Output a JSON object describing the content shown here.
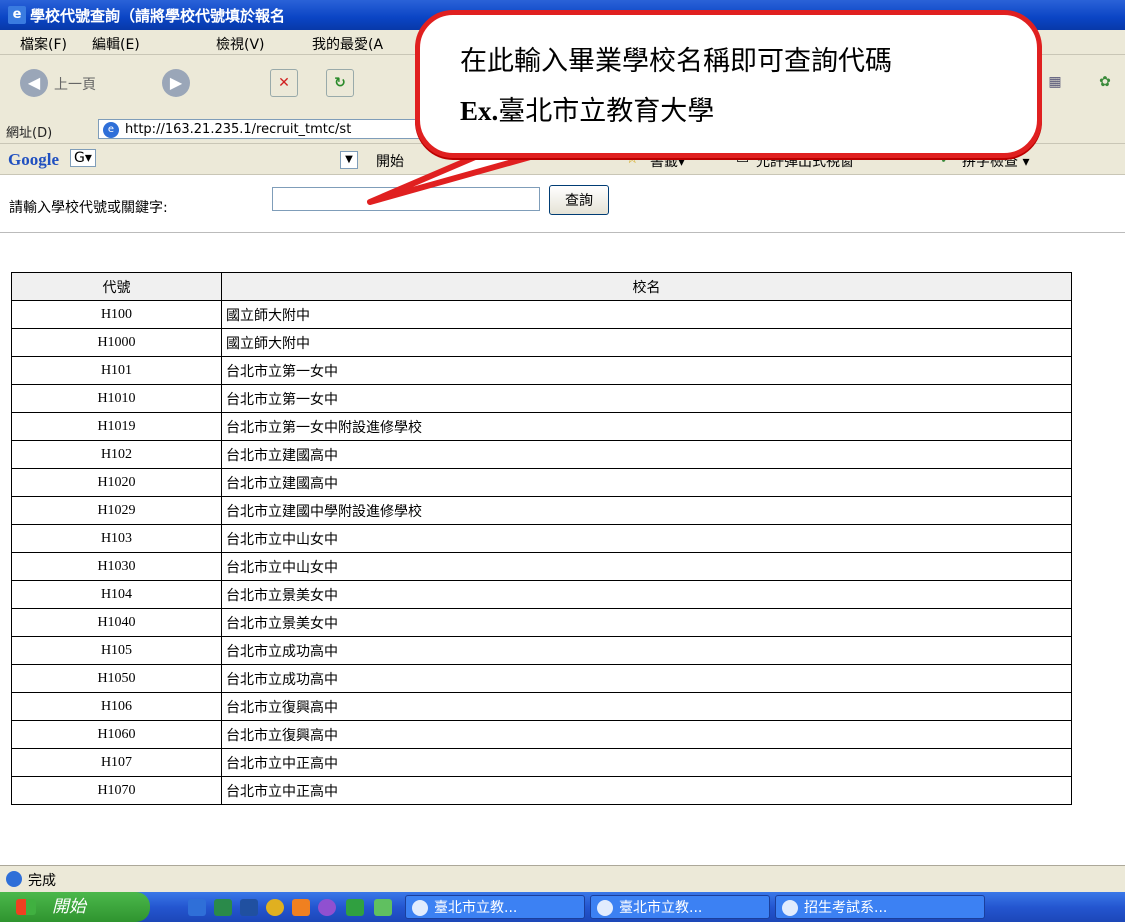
{
  "window": {
    "title": "學校代號查詢（請將學校代號填於報名"
  },
  "menu": {
    "file": "檔案(F)",
    "edit": "編輯(E)",
    "view": "檢視(V)",
    "favorites": "我的最愛(A"
  },
  "toolbar": {
    "back_label": "上一頁"
  },
  "address": {
    "label": "網址(D)",
    "url": "http://163.21.235.1/recruit_tmtc/st"
  },
  "googlebar": {
    "brand": "Google",
    "g_box": "G▾",
    "start": "開始",
    "bookmarks": "書籤▾",
    "popups": "允許彈出式視窗",
    "spellcheck": "拼字檢查 ▾"
  },
  "search": {
    "label": "請輸入學校代號或關鍵字:",
    "value": "",
    "button": "查詢"
  },
  "callout": {
    "line1": "在此輸入畢業學校名稱即可查詢代碼",
    "line2_prefix": "Ex.",
    "line2_rest": "臺北市立教育大學"
  },
  "table": {
    "headers": [
      "代號",
      "校名"
    ],
    "rows": [
      [
        "H100",
        "國立師大附中"
      ],
      [
        "H1000",
        "國立師大附中"
      ],
      [
        "H101",
        "台北市立第一女中"
      ],
      [
        "H1010",
        "台北市立第一女中"
      ],
      [
        "H1019",
        "台北市立第一女中附設進修學校"
      ],
      [
        "H102",
        "台北市立建國高中"
      ],
      [
        "H1020",
        "台北市立建國高中"
      ],
      [
        "H1029",
        "台北市立建國中學附設進修學校"
      ],
      [
        "H103",
        "台北市立中山女中"
      ],
      [
        "H1030",
        "台北市立中山女中"
      ],
      [
        "H104",
        "台北市立景美女中"
      ],
      [
        "H1040",
        "台北市立景美女中"
      ],
      [
        "H105",
        "台北市立成功高中"
      ],
      [
        "H1050",
        "台北市立成功高中"
      ],
      [
        "H106",
        "台北市立復興高中"
      ],
      [
        "H1060",
        "台北市立復興高中"
      ],
      [
        "H107",
        "台北市立中正高中"
      ],
      [
        "H1070",
        "台北市立中正高中"
      ]
    ]
  },
  "status": {
    "text": "完成"
  },
  "taskbar": {
    "start": "開始",
    "tasks": [
      "臺北市立教...",
      "臺北市立教...",
      "招生考試系..."
    ]
  },
  "colors": {
    "callout_border": "#e02020",
    "titlebar": "#0a44c4",
    "taskbar": "#2456d0",
    "start": "#2f942f"
  }
}
